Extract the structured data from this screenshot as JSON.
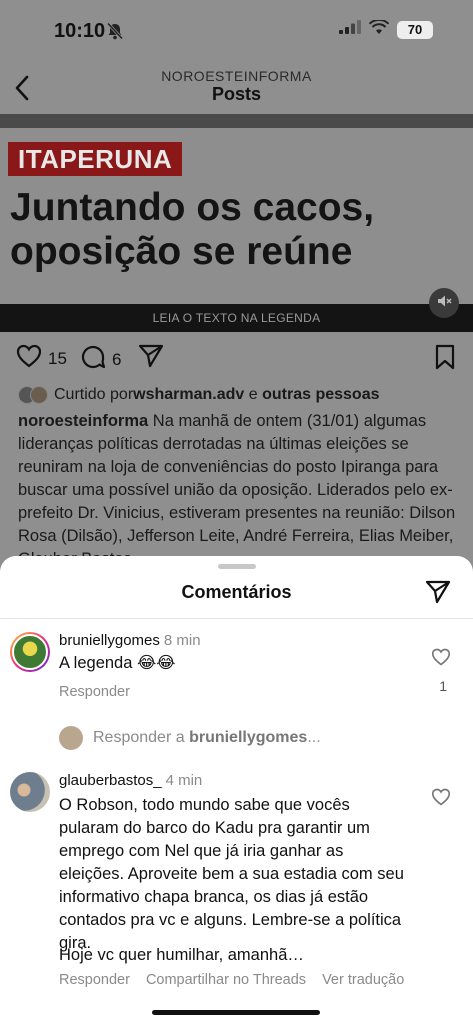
{
  "status_bar": {
    "time": "10:10",
    "battery": "70"
  },
  "header": {
    "account": "NOROESTEINFORMA",
    "title": "Posts"
  },
  "post_image": {
    "tag": "ITAPERUNA",
    "headline_line1": "Juntando os cacos,",
    "headline_line2": "oposição se reúne",
    "caption_strip": "LEIA O TEXTO NA LEGENDA"
  },
  "actions": {
    "likes": "15",
    "comments": "6"
  },
  "liked_by": {
    "prefix": "Curtido por ",
    "user": "wsharman.adv",
    "middle": " e ",
    "others": "outras pessoas"
  },
  "caption": {
    "user": "noroesteinforma",
    "text": " Na manhã de ontem (31/01) algumas lideranças políticas derrotadas na últimas eleições se reuniram na loja de conveniências do posto Ipiranga para buscar uma possível união da oposição. Liderados pelo ex-prefeito Dr. Vinicius, estiveram presentes na reunião: Dilson Rosa (Dilsão), Jefferson Leite, André Ferreira, Elias Meiber, Glauber Bastos,"
  },
  "sheet": {
    "title": "Comentários",
    "comments": [
      {
        "user": "bruniellygomes",
        "time": "8 min",
        "text": "A legenda 😂😂",
        "reply_label": "Responder",
        "likes": "1"
      },
      {
        "user": "glauberbastos_",
        "time": "4 min",
        "text": "O Robson, todo mundo sabe que vocês pularam do barco do Kadu pra garantir um emprego com Nel que já iria ganhar as eleições. Aproveite bem a sua estadia com seu informativo chapa branca, os dias já estão contados pra vc e alguns. Lembre-se a política gira.",
        "text2": "Hoje vc quer humilhar, amanhã…",
        "reply_label": "Responder",
        "threads_label": "Compartilhar no Threads",
        "translate_label": "Ver tradução"
      }
    ],
    "reply_prompt": {
      "prefix": "Responder a ",
      "user": "bruniellygomes",
      "suffix": "..."
    }
  },
  "colors": {
    "sheet_bg": "#ffffff",
    "dim_bg": "#8f8f8f",
    "tag_bg": "#8a1818",
    "muted_text": "#8a8a8a"
  },
  "icons": [
    "back-chevron-icon",
    "bell-off-icon",
    "signal-icon",
    "wifi-icon",
    "heart-icon",
    "comment-icon",
    "send-icon",
    "bookmark-icon",
    "mute-icon"
  ]
}
